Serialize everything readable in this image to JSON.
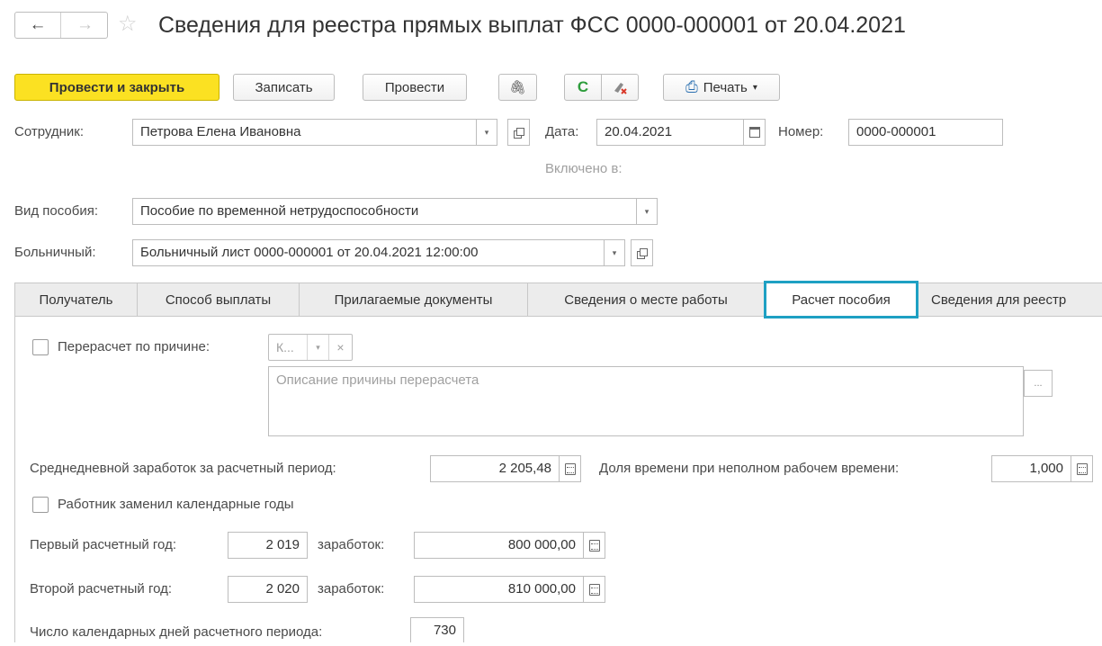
{
  "header": {
    "back_glyph": "←",
    "forward_glyph": "→",
    "favorite_glyph": "☆",
    "title": "Сведения для реестра прямых выплат ФСС 0000-000001 от 20.04.2021"
  },
  "toolbar": {
    "post_and_close": "Провести и закрыть",
    "save": "Записать",
    "post": "Провести",
    "attach_glyph": "🖇",
    "refresh_glyph": "C",
    "print_glyph": "⎙",
    "print": "Печать",
    "print_caret": "▾"
  },
  "form": {
    "employee_label": "Сотрудник:",
    "employee_value": "Петрова Елена Ивановна",
    "date_label": "Дата:",
    "date_value": "20.04.2021",
    "number_label": "Номер:",
    "number_value": "0000-000001",
    "included_label": "Включено в:",
    "benefit_type_label": "Вид пособия:",
    "benefit_type_value": "Пособие по временной нетрудоспособности",
    "sick_leave_label": "Больничный:",
    "sick_leave_value": "Больничный лист 0000-000001 от 20.04.2021 12:00:00",
    "dropdown_glyph": "▾"
  },
  "tabs": [
    {
      "label": "Получатель"
    },
    {
      "label": "Способ выплаты"
    },
    {
      "label": "Прилагаемые документы"
    },
    {
      "label": "Сведения о месте работы"
    },
    {
      "label": "Расчет пособия"
    },
    {
      "label": "Сведения для реестр"
    }
  ],
  "calc": {
    "recalc_label": "Перерасчет по причине:",
    "recalc_reason_short": "К...",
    "dropdown_glyph": "▾",
    "clear_glyph": "×",
    "reason_placeholder": "Описание причины перерасчета",
    "ellipsis_glyph": "...",
    "avg_earnings_label": "Среднедневной заработок за расчетный период:",
    "avg_earnings_value": "2 205,48",
    "parttime_label": "Доля времени при неполном рабочем времени:",
    "parttime_value": "1,000",
    "replaced_years_label": "Работник заменил календарные годы",
    "year1_label": "Первый расчетный год:",
    "year1_value": "2 019",
    "earnings_label": "заработок:",
    "year1_earnings": "800 000,00",
    "year2_label": "Второй расчетный год:",
    "year2_value": "2 020",
    "year2_earnings": "810 000,00",
    "days_label": "Число календарных дней расчетного периода:",
    "days_value": "730"
  },
  "colors": {
    "primary_button": "#fbe122",
    "active_tab_border": "#1ea0c3",
    "refresh_green": "#2e9d3c",
    "clear_red": "#d93a2b",
    "print_blue": "#2a6fb0"
  }
}
